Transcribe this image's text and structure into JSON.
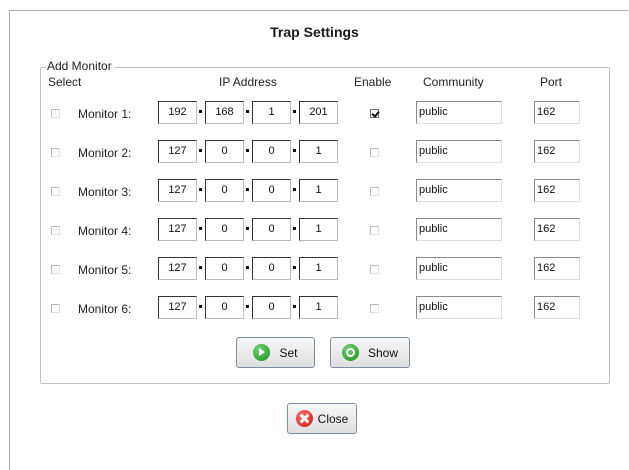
{
  "title": "Trap Settings",
  "group": {
    "legend": "Add Monitor",
    "headers": {
      "select": "Select",
      "ip": "IP Address",
      "enable": "Enable",
      "community": "Community",
      "port": "Port"
    }
  },
  "monitors": [
    {
      "label": "Monitor 1:",
      "selected": false,
      "ip": [
        "192",
        "168",
        "1",
        "201"
      ],
      "enabled": true,
      "community": "public",
      "port": "162"
    },
    {
      "label": "Monitor 2:",
      "selected": false,
      "ip": [
        "127",
        "0",
        "0",
        "1"
      ],
      "enabled": false,
      "community": "public",
      "port": "162"
    },
    {
      "label": "Monitor 3:",
      "selected": false,
      "ip": [
        "127",
        "0",
        "0",
        "1"
      ],
      "enabled": false,
      "community": "public",
      "port": "162"
    },
    {
      "label": "Monitor 4:",
      "selected": false,
      "ip": [
        "127",
        "0",
        "0",
        "1"
      ],
      "enabled": false,
      "community": "public",
      "port": "162"
    },
    {
      "label": "Monitor 5:",
      "selected": false,
      "ip": [
        "127",
        "0",
        "0",
        "1"
      ],
      "enabled": false,
      "community": "public",
      "port": "162"
    },
    {
      "label": "Monitor 6:",
      "selected": false,
      "ip": [
        "127",
        "0",
        "0",
        "1"
      ],
      "enabled": false,
      "community": "public",
      "port": "162"
    }
  ],
  "buttons": {
    "set": {
      "label": "Set",
      "icon": "go-icon"
    },
    "show": {
      "label": "Show",
      "icon": "show-icon"
    },
    "close": {
      "label": "Close",
      "icon": "close-icon"
    }
  }
}
